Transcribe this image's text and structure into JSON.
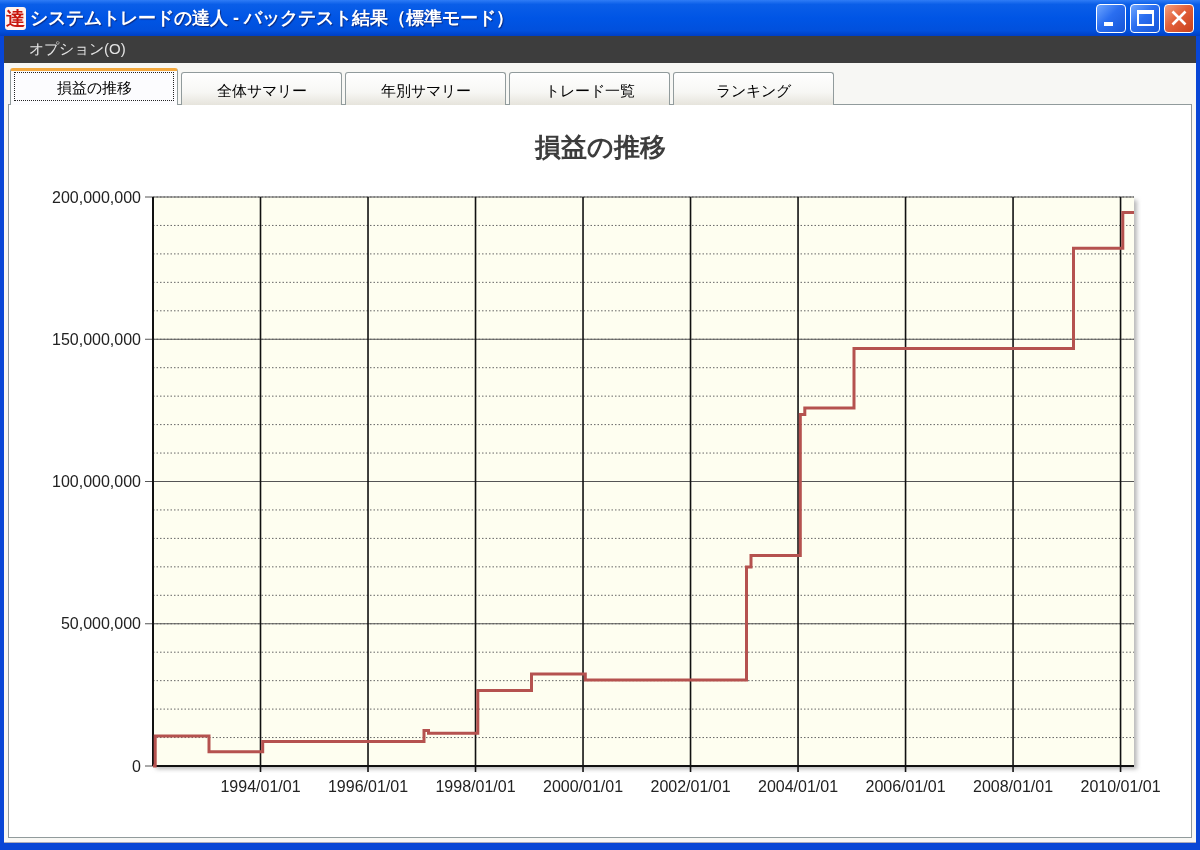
{
  "window": {
    "icon_text": "達",
    "title": "システムトレードの達人 - バックテスト結果（標準モード）"
  },
  "menu": [
    {
      "label": "オプション(O)"
    }
  ],
  "tabs": [
    {
      "label": "損益の推移",
      "selected": true
    },
    {
      "label": "全体サマリー",
      "selected": false
    },
    {
      "label": "年別サマリー",
      "selected": false
    },
    {
      "label": "トレード一覧",
      "selected": false
    },
    {
      "label": "ランキング",
      "selected": false
    }
  ],
  "panel": {
    "chart_data": {
      "type": "line",
      "title": "損益の推移",
      "grid": true,
      "categories": [
        null,
        null,
        null,
        null,
        null,
        null,
        null,
        null,
        null,
        null,
        null,
        null,
        null,
        null,
        null,
        null,
        null,
        null,
        null,
        null,
        null,
        null,
        null,
        null,
        "1994/01/01",
        null,
        null,
        null,
        null,
        null,
        null,
        null,
        null,
        null,
        null,
        null,
        null,
        null,
        null,
        null,
        null,
        null,
        null,
        null,
        null,
        null,
        null,
        null,
        "1996/01/01",
        null,
        null,
        null,
        null,
        null,
        null,
        null,
        null,
        null,
        null,
        null,
        null,
        null,
        null,
        null,
        null,
        null,
        null,
        null,
        null,
        null,
        null,
        null,
        "1998/01/01",
        null,
        null,
        null,
        null,
        null,
        null,
        null,
        null,
        null,
        null,
        null,
        null,
        null,
        null,
        null,
        null,
        null,
        null,
        null,
        null,
        null,
        null,
        null,
        "2000/01/01",
        null,
        null,
        null,
        null,
        null,
        null,
        null,
        null,
        null,
        null,
        null,
        null,
        null,
        null,
        null,
        null,
        null,
        null,
        null,
        null,
        null,
        null,
        null,
        "2002/01/01",
        null,
        null,
        null,
        null,
        null,
        null,
        null,
        null,
        null,
        null,
        null,
        null,
        null,
        null,
        null,
        null,
        null,
        null,
        null,
        null,
        null,
        null,
        null,
        "2004/01/01",
        null,
        null,
        null,
        null,
        null,
        null,
        null,
        null,
        null,
        null,
        null,
        null,
        null,
        null,
        null,
        null,
        null,
        null,
        null,
        null,
        null,
        null,
        null,
        "2006/01/01",
        null,
        null,
        null,
        null,
        null,
        null,
        null,
        null,
        null,
        null,
        null,
        null,
        null,
        null,
        null,
        null,
        null,
        null,
        null,
        null,
        null,
        null,
        null,
        "2008/01/01",
        null,
        null,
        null,
        null,
        null,
        null,
        null,
        null,
        null,
        null,
        null,
        null,
        null,
        null,
        null,
        null,
        null,
        null,
        null,
        null,
        null,
        null,
        null,
        "2010/01/01",
        null,
        null,
        null
      ],
      "series": [
        {
          "color": "#b5524f",
          "values": [
            0,
            10500000,
            10500000,
            10500000,
            10500000,
            10500000,
            10500000,
            10500000,
            10500000,
            10500000,
            10500000,
            10500000,
            10500000,
            5000000,
            5000000,
            5000000,
            5000000,
            5000000,
            5000000,
            5000000,
            5000000,
            5000000,
            5000000,
            5000000,
            5000000,
            8600000,
            8600000,
            8600000,
            8600000,
            8600000,
            8600000,
            8600000,
            8600000,
            8600000,
            8600000,
            8600000,
            8600000,
            8600000,
            8600000,
            8600000,
            8600000,
            8600000,
            8600000,
            8600000,
            8600000,
            8600000,
            8600000,
            8600000,
            8600000,
            8600000,
            8600000,
            8600000,
            8600000,
            8600000,
            8600000,
            8600000,
            8600000,
            8600000,
            8600000,
            8600000,
            8600000,
            12500000,
            11500000,
            11500000,
            11500000,
            11500000,
            11500000,
            11500000,
            11500000,
            11500000,
            11500000,
            11500000,
            11500000,
            26500000,
            26500000,
            26500000,
            26500000,
            26500000,
            26500000,
            26500000,
            26500000,
            26500000,
            26500000,
            26500000,
            26500000,
            32300000,
            32300000,
            32300000,
            32300000,
            32300000,
            32300000,
            32300000,
            32300000,
            32300000,
            32300000,
            32300000,
            32300000,
            30200000,
            30200000,
            30200000,
            30200000,
            30200000,
            30200000,
            30200000,
            30200000,
            30200000,
            30200000,
            30200000,
            30200000,
            30200000,
            30200000,
            30200000,
            30200000,
            30200000,
            30200000,
            30200000,
            30200000,
            30200000,
            30200000,
            30200000,
            30200000,
            30200000,
            30200000,
            30200000,
            30200000,
            30200000,
            30200000,
            30200000,
            30200000,
            30200000,
            30200000,
            30200000,
            30200000,
            70000000,
            74000000,
            74000000,
            74000000,
            74000000,
            74000000,
            74000000,
            74000000,
            74000000,
            74000000,
            74000000,
            74000000,
            123500000,
            125800000,
            125800000,
            125800000,
            125800000,
            125800000,
            125800000,
            125800000,
            125800000,
            125800000,
            125800000,
            125800000,
            146700000,
            146700000,
            146700000,
            146700000,
            146700000,
            146700000,
            146700000,
            146700000,
            146700000,
            146700000,
            146700000,
            146700000,
            146700000,
            146700000,
            146700000,
            146700000,
            146700000,
            146700000,
            146700000,
            146700000,
            146700000,
            146700000,
            146700000,
            146700000,
            146700000,
            146700000,
            146700000,
            146700000,
            146700000,
            146700000,
            146700000,
            146700000,
            146700000,
            146700000,
            146700000,
            146700000,
            146700000,
            146700000,
            146700000,
            146700000,
            146700000,
            146700000,
            146700000,
            146700000,
            146700000,
            146700000,
            146700000,
            146700000,
            146700000,
            182000000,
            182000000,
            182000000,
            182000000,
            182000000,
            182000000,
            182000000,
            182000000,
            182000000,
            182000000,
            182000000,
            194500000,
            194500000,
            194500000
          ]
        }
      ],
      "ylim": [
        0,
        200000000
      ],
      "yticks": [
        {
          "value": 0,
          "label": "0"
        },
        {
          "value": 50000000,
          "label": "50,000,000"
        },
        {
          "value": 100000000,
          "label": "100,000,000"
        },
        {
          "value": 150000000,
          "label": "150,000,000"
        },
        {
          "value": 200000000,
          "label": "200,000,000"
        }
      ]
    }
  }
}
